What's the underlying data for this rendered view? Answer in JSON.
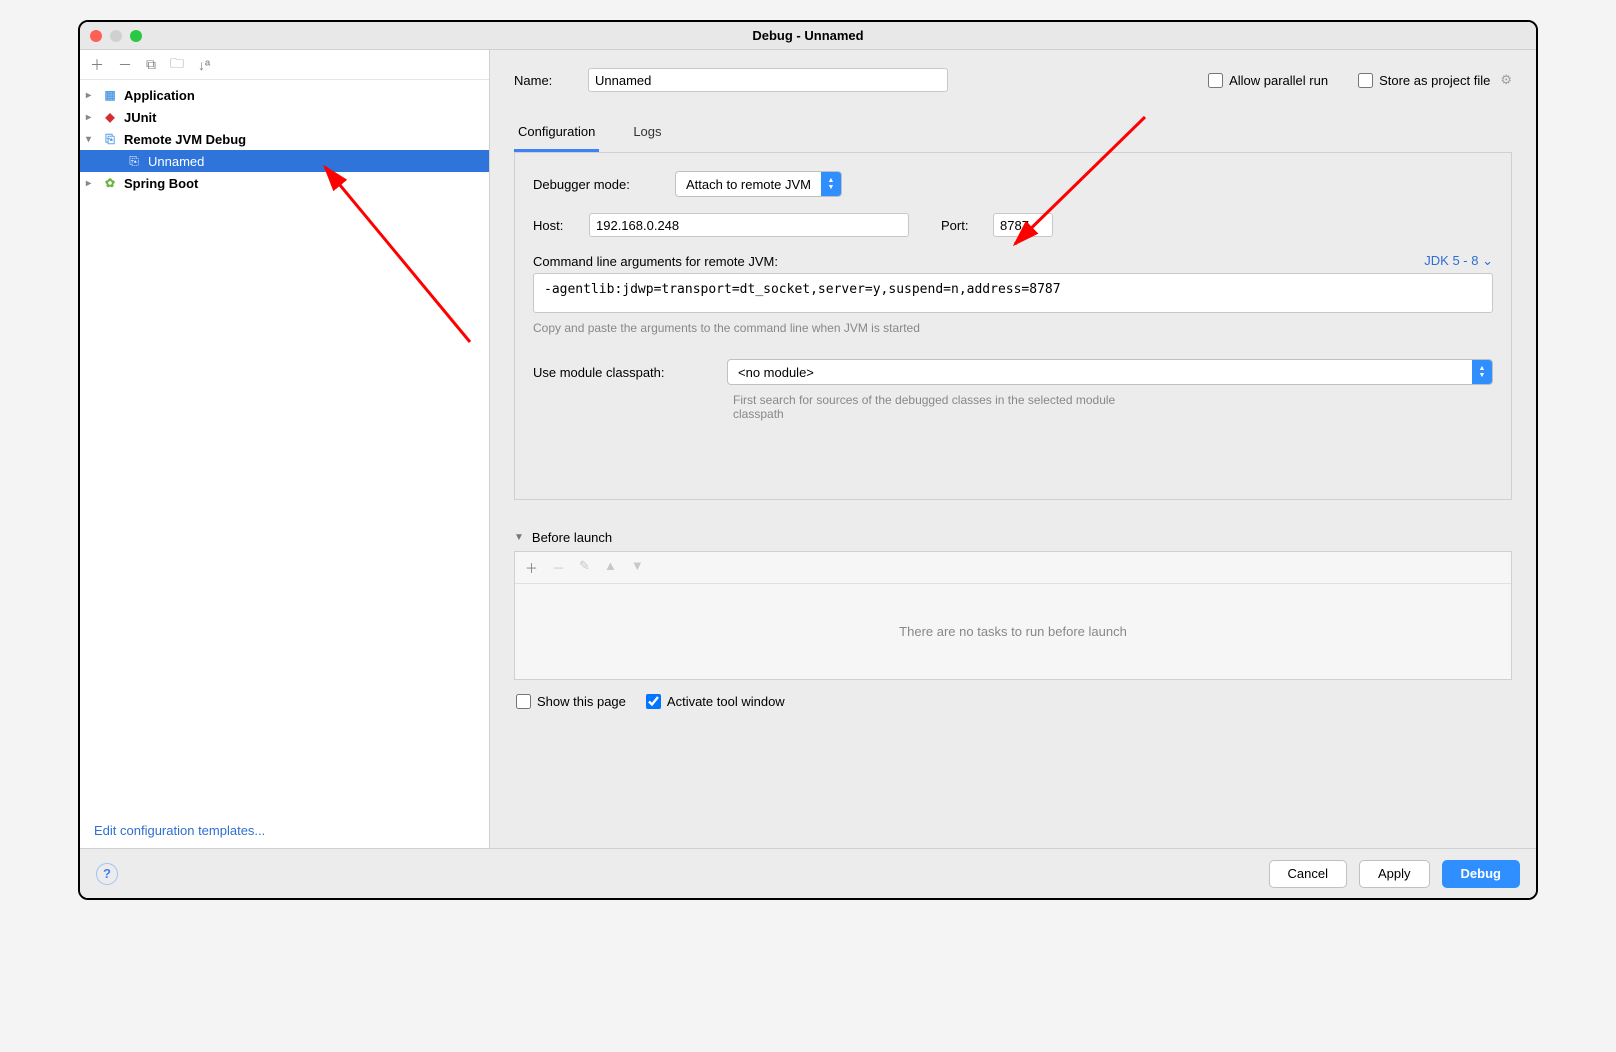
{
  "window": {
    "title": "Debug - Unnamed"
  },
  "sidebar": {
    "items": [
      {
        "label": "Application"
      },
      {
        "label": "JUnit"
      },
      {
        "label": "Remote JVM Debug"
      },
      {
        "label": "Unnamed"
      },
      {
        "label": "Spring Boot"
      }
    ],
    "edit_templates": "Edit configuration templates..."
  },
  "header": {
    "name_label": "Name:",
    "name_value": "Unnamed",
    "allow_parallel": "Allow parallel run",
    "store_project": "Store as project file"
  },
  "tabs": {
    "configuration": "Configuration",
    "logs": "Logs"
  },
  "config": {
    "debugger_mode_label": "Debugger mode:",
    "debugger_mode_value": "Attach to remote JVM",
    "host_label": "Host:",
    "host_value": "192.168.0.248",
    "port_label": "Port:",
    "port_value": "8787",
    "cmd_label": "Command line arguments for remote JVM:",
    "jdk_label": "JDK 5 - 8",
    "cmd_value": "-agentlib:jdwp=transport=dt_socket,server=y,suspend=n,address=8787",
    "cmd_hint": "Copy and paste the arguments to the command line when JVM is started",
    "module_label": "Use module classpath:",
    "module_value": "<no module>",
    "module_hint": "First search for sources of the debugged classes in the selected module classpath"
  },
  "before_launch": {
    "title": "Before launch",
    "empty": "There are no tasks to run before launch"
  },
  "show": {
    "show_page": "Show this page",
    "activate_tool": "Activate tool window"
  },
  "footer": {
    "cancel": "Cancel",
    "apply": "Apply",
    "debug": "Debug"
  }
}
